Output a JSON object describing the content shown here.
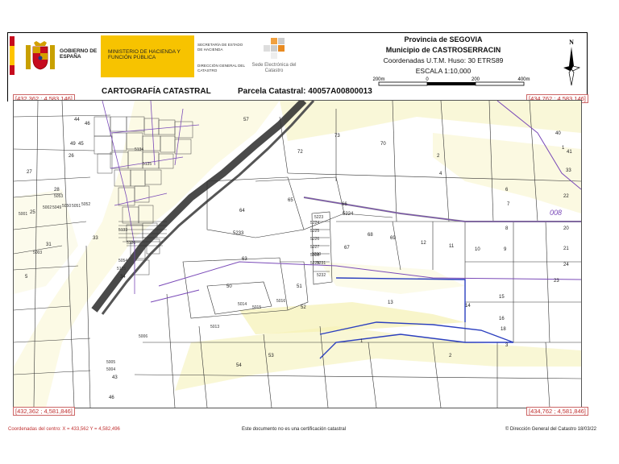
{
  "header": {
    "gob_label": "GOBIERNO DE ESPAÑA",
    "ministry_label": "MINISTERIO DE HACIENDA Y FUNCIÓN PÚBLICA",
    "secretaria_label": "SECRETARÍA DE ESTADO DE HACIENDA",
    "direccion_label": "DIRECCIÓN GENERAL DEL CATASTRO",
    "sede_label": "Sede Electrónica del Catastro",
    "province": "Provincia de SEGOVIA",
    "municipality": "Municipio de CASTROSERRACIN",
    "coords": "Coordenadas U.T.M. Huso: 30 ETRS89",
    "scale": "ESCALA 1:10,000",
    "north_label": "N"
  },
  "scalebar": {
    "labels": [
      "200m",
      "0",
      "200",
      "400m"
    ]
  },
  "titles": {
    "left": "CARTOGRAFÍA CATASTRAL",
    "parcel": "Parcela Catastral: 40057A00800013"
  },
  "corners": {
    "top_left": "[432,362 ; 4,583,146]",
    "top_right": "[434,762 ; 4,583,146]",
    "bottom_left": "[432,362 ; 4,581,846]",
    "bottom_right": "[434,762 ; 4,581,846]"
  },
  "map_labels": {
    "parcels": [
      "44",
      "46",
      "49",
      "45",
      "57",
      "70",
      "40",
      "72",
      "1",
      "73",
      "2",
      "33",
      "4",
      "6",
      "26",
      "27",
      "28",
      "25",
      "31",
      "33",
      "5",
      "8",
      "20",
      "21",
      "64",
      "65",
      "66",
      "12",
      "11",
      "10",
      "9",
      "5233",
      "5224",
      "63",
      "67",
      "69",
      "68",
      "51",
      "50",
      "52",
      "13",
      "14",
      "16",
      "15",
      "43",
      "46",
      "34",
      "54",
      "53",
      "1",
      "2",
      "3",
      "18",
      "7",
      "23",
      "24",
      "22",
      "41"
    ],
    "codes": [
      "5223",
      "5224",
      "5225",
      "5226",
      "5227",
      "5228",
      "5229",
      "5230",
      "5231",
      "5232",
      "5014",
      "5015",
      "5016",
      "5013",
      "5006",
      "5005",
      "5004",
      "5003",
      "5001",
      "5002",
      "5049",
      "5050",
      "5051",
      "5052",
      "5053",
      "5054",
      "5125",
      "5126",
      "5133",
      "5134",
      "5135"
    ],
    "polygon_label": "008"
  },
  "footer": {
    "center_coords": "Coordenadas del centro: X = 433,562 Y = 4,582,496",
    "disclaimer": "Este documento no es una certificación catastral",
    "copyright": "© Dirección General del Catastro 18/03/22"
  },
  "colors": {
    "gob_yellow": "#f7c300",
    "corner_red": "#c03030",
    "boundary_purple": "#7a4ab8",
    "boundary_blue": "#2b3fbf",
    "relief_yellow": "#f2ec9a",
    "parcel_line": "#333333"
  }
}
